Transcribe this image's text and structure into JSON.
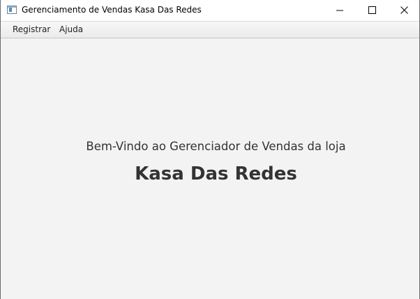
{
  "window": {
    "title": "Gerenciamento de Vendas Kasa Das Redes",
    "icon": "app-window-icon",
    "controls": [
      "minimize-icon",
      "maximize-icon",
      "close-icon"
    ]
  },
  "menubar": {
    "items": [
      {
        "label": "Registrar"
      },
      {
        "label": "Ajuda"
      }
    ]
  },
  "main": {
    "welcome_text": "Bem-Vindo ao Gerenciador de Vendas da loja",
    "store_name": "Kasa Das Redes"
  },
  "colors": {
    "background": "#f3f3f3",
    "text": "#333333",
    "titlebar": "#ffffff"
  }
}
